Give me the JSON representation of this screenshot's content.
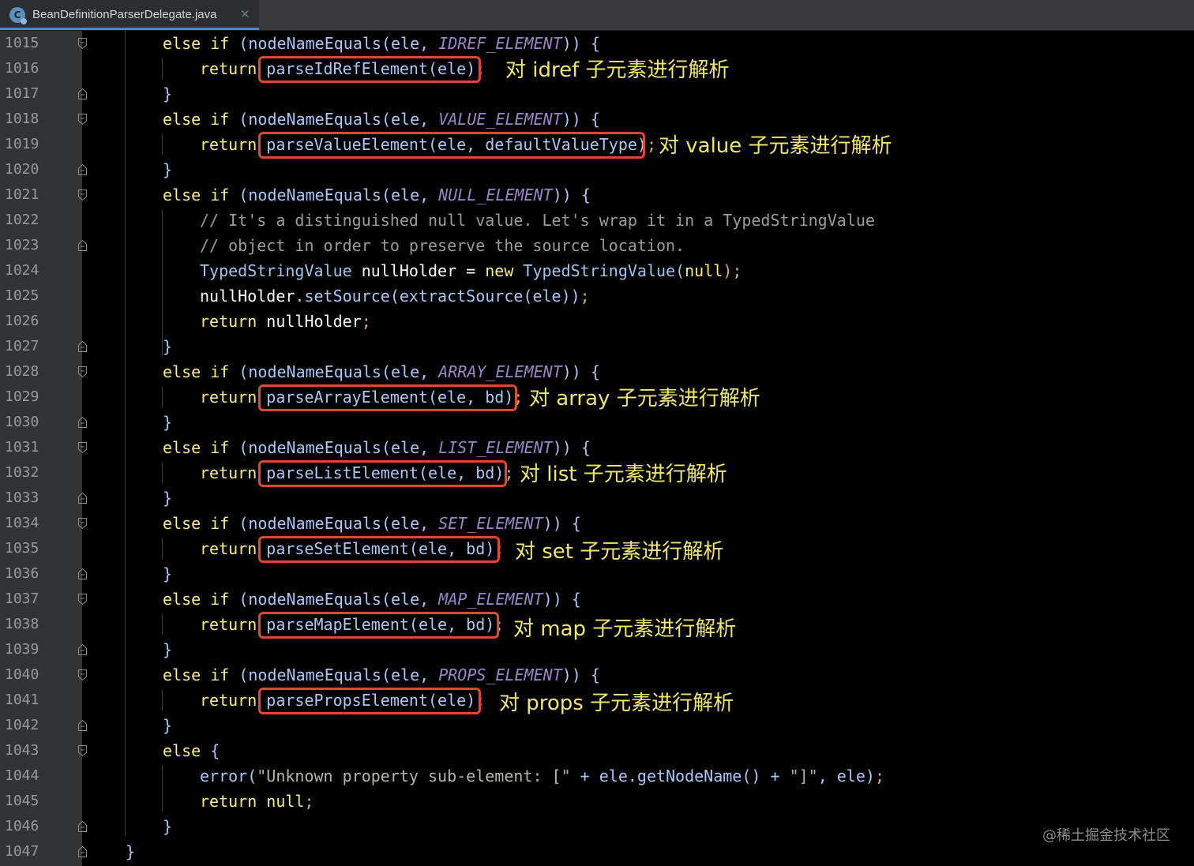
{
  "tab": {
    "file_name": "BeanDefinitionParserDelegate.java",
    "icon_letter": "C",
    "close_glyph": "✕"
  },
  "line_numbers": [
    "1015",
    "1016",
    "1017",
    "1018",
    "1019",
    "1020",
    "1021",
    "1022",
    "1023",
    "1024",
    "1025",
    "1026",
    "1027",
    "1028",
    "1029",
    "1030",
    "1031",
    "1032",
    "1033",
    "1034",
    "1035",
    "1036",
    "1037",
    "1038",
    "1039",
    "1040",
    "1041",
    "1042",
    "1043",
    "1044",
    "1045",
    "1046",
    "1047"
  ],
  "code": {
    "l1015": {
      "kw1": "else if ",
      "fn": "(nodeNameEquals(ele, ",
      "cst": "IDREF_ELEMENT",
      "end": ")) {"
    },
    "l1016": {
      "kw": "return ",
      "call": "parseIdRefElement(ele)",
      "semi": ";"
    },
    "l1017": {
      "text": "}"
    },
    "l1018": {
      "kw1": "else if ",
      "fn": "(nodeNameEquals(ele, ",
      "cst": "VALUE_ELEMENT",
      "end": ")) {"
    },
    "l1019": {
      "kw": "return ",
      "call": "parseValueElement(ele, defaultValueType)",
      "semi": ";"
    },
    "l1020": {
      "text": "}"
    },
    "l1021": {
      "kw1": "else if ",
      "fn": "(nodeNameEquals(ele, ",
      "cst": "NULL_ELEMENT",
      "end": ")) {"
    },
    "l1022": {
      "text": "// It's a distinguished null value. Let's wrap it in a TypedStringValue"
    },
    "l1023": {
      "text": "// object in order to preserve the source location."
    },
    "l1024": {
      "t1": "TypedStringValue ",
      "t2": "nullHolder = ",
      "t3": "new ",
      "t4": "TypedStringValue(",
      "t5": "null",
      "t6": ");"
    },
    "l1025": {
      "t1": "nullHolder",
      "t2": ".setSource(extractSource(ele))",
      "t3": ";"
    },
    "l1026": {
      "t1": "return ",
      "t2": "nullHolder",
      "t3": ";"
    },
    "l1027": {
      "text": "}"
    },
    "l1028": {
      "kw1": "else if ",
      "fn": "(nodeNameEquals(ele, ",
      "cst": "ARRAY_ELEMENT",
      "end": ")) {"
    },
    "l1029": {
      "kw": "return ",
      "call": "parseArrayElement(ele, bd)",
      "semi": ";"
    },
    "l1030": {
      "text": "}"
    },
    "l1031": {
      "kw1": "else if ",
      "fn": "(nodeNameEquals(ele, ",
      "cst": "LIST_ELEMENT",
      "end": ")) {"
    },
    "l1032": {
      "kw": "return ",
      "call": "parseListElement(ele, bd)",
      "semi": ";"
    },
    "l1033": {
      "text": "}"
    },
    "l1034": {
      "kw1": "else if ",
      "fn": "(nodeNameEquals(ele, ",
      "cst": "SET_ELEMENT",
      "end": ")) {"
    },
    "l1035": {
      "kw": "return ",
      "call": "parseSetElement(ele, bd)",
      "semi": ";"
    },
    "l1036": {
      "text": "}"
    },
    "l1037": {
      "kw1": "else if ",
      "fn": "(nodeNameEquals(ele, ",
      "cst": "MAP_ELEMENT",
      "end": ")) {"
    },
    "l1038": {
      "kw": "return ",
      "call": "parseMapElement(ele, bd)",
      "semi": ";"
    },
    "l1039": {
      "text": "}"
    },
    "l1040": {
      "kw1": "else if ",
      "fn": "(nodeNameEquals(ele, ",
      "cst": "PROPS_ELEMENT",
      "end": ")) {"
    },
    "l1041": {
      "kw": "return ",
      "call": "parsePropsElement(ele)",
      "semi": ";"
    },
    "l1042": {
      "text": "}"
    },
    "l1043": {
      "kw": "else ",
      "end": "{"
    },
    "l1044": {
      "t1": "error(",
      "t2": "\"Unknown property sub-element: [\"",
      "t3": " + ele.getNodeName() + ",
      "t4": "\"]\"",
      "t5": ", ele)",
      "t6": ";"
    },
    "l1045": {
      "t1": "return ",
      "t2": "null",
      "t3": ";"
    },
    "l1046": {
      "text": "}"
    },
    "l1047": {
      "text": "}"
    }
  },
  "annotations": {
    "idref": "对 idref 子元素进行解析",
    "value": "对 value 子元素进行解析",
    "array": "对 array 子元素进行解析",
    "list": "对 list 子元素进行解析",
    "set": "对 set 子元素进行解析",
    "map": "对 map 子元素进行解析",
    "props": "对 props 子元素进行解析"
  },
  "watermark": "@稀土掘金技术社区",
  "colors": {
    "background": "#000000",
    "gutter": "#313335",
    "keyword": "#f9ee82",
    "highlight_box": "#e04a2c",
    "annotation": "#f1e66c",
    "constant": "#9a86c8"
  }
}
